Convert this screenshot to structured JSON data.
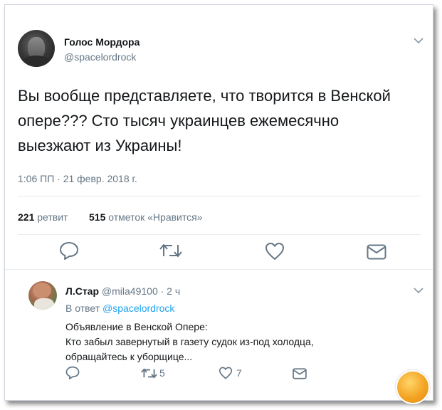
{
  "tweet": {
    "author_name": "Голос Мордора",
    "author_handle": "@spacelordrock",
    "text_lines": [
      "Вы вообще представляете, что творится в Венской",
      "опере??? Сто тысяч украинцев ежемесячно",
      "выезжают из Украины!"
    ],
    "timestamp": "1:06 ПП · 21 февр. 2018 г.",
    "retweets_count": "221",
    "retweets_label": "ретвит",
    "likes_count": "515",
    "likes_label": "отметок «Нравится»",
    "icons": [
      "reply-icon",
      "retweet-icon",
      "like-icon",
      "message-icon",
      "chevron-down-icon"
    ]
  },
  "reply": {
    "author_name": "Л.Стар",
    "author_handle": "@mila49100",
    "time": "· 2 ч",
    "reply_to_prefix": "В ответ",
    "reply_to_handle": "@spacelordrock",
    "text_lines": [
      "Объявление в Венской Опере:",
      "Кто забыл завернутый в газету судок из-под холодца,",
      "обращайтесь к уборщице..."
    ],
    "retweet_count": "5",
    "like_count": "7"
  },
  "colors": {
    "text": "#14171a",
    "secondary": "#657786",
    "link": "#1da1f2",
    "divider": "#e6ecf0",
    "icon": "#657786"
  }
}
